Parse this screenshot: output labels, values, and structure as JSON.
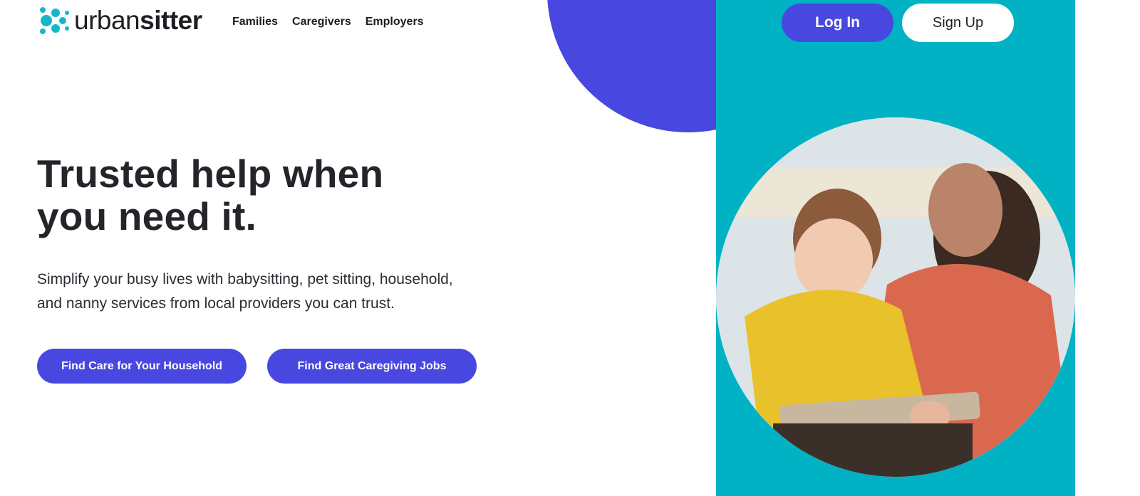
{
  "brand": {
    "name_part1": "urban",
    "name_part2": "sitter",
    "logo_color": "#15b8c9"
  },
  "nav": {
    "items": [
      "Families",
      "Caregivers",
      "Employers"
    ]
  },
  "auth": {
    "login": "Log In",
    "signup": "Sign Up"
  },
  "hero": {
    "title_line1": "Trusted help when",
    "title_line2": "you need it.",
    "subtitle_line1": "Simplify your busy lives with babysitting, pet sitting, household,",
    "subtitle_line2": "and nanny services from local providers you can trust.",
    "cta_primary": "Find Care for Your Household",
    "cta_secondary": "Find Great Caregiving Jobs"
  },
  "colors": {
    "accent": "#4848e0",
    "teal": "#00b2c4",
    "text": "#24252a"
  }
}
